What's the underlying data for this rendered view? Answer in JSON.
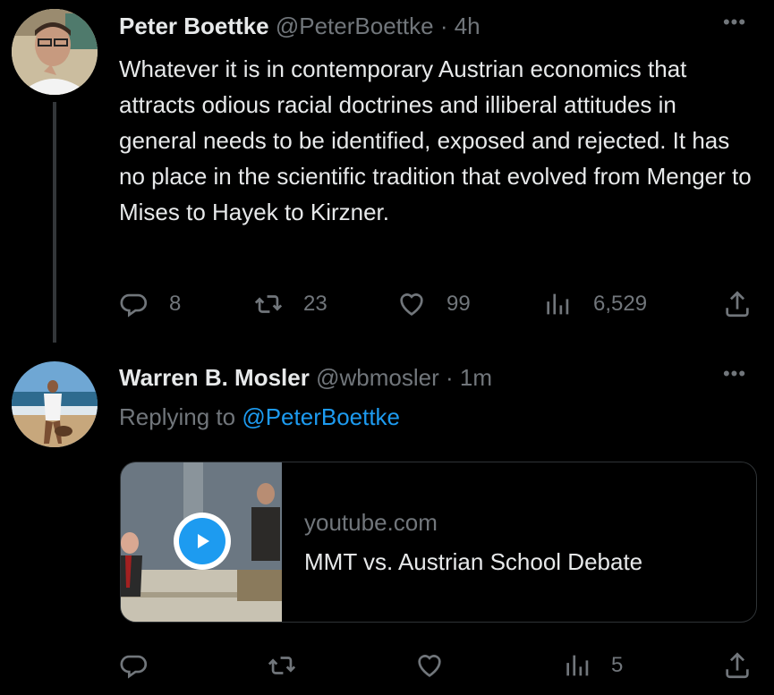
{
  "tweets": [
    {
      "name": "Peter Boettke",
      "handle": "@PeterBoettke",
      "separator": "·",
      "time": "4h",
      "more": "•••",
      "text": "Whatever it is in contemporary Austrian economics that attracts odious racial doctrines and illiberal attitudes in general needs to be identified, exposed and rejected.  It has no place in the scientific tradition that evolved from Menger to Mises to Hayek to Kirzner.",
      "actions": {
        "replies": "8",
        "retweets": "23",
        "likes": "99",
        "views": "6,529"
      }
    },
    {
      "name": "Warren B. Mosler",
      "handle": "@wbmosler",
      "separator": "·",
      "time": "1m",
      "more": "•••",
      "replying_prefix": "Replying to ",
      "replying_to": "@PeterBoettke",
      "card": {
        "domain": "youtube.com",
        "title": "MMT vs. Austrian School Debate"
      },
      "actions": {
        "views": "5"
      }
    }
  ],
  "icons": [
    "reply-icon",
    "retweet-icon",
    "like-icon",
    "views-icon",
    "share-icon",
    "more-icon",
    "play-icon"
  ],
  "colors": {
    "background": "#000000",
    "text": "#e7e9ea",
    "muted": "#71767b",
    "link": "#1d9bf0",
    "border": "#2f3336"
  }
}
